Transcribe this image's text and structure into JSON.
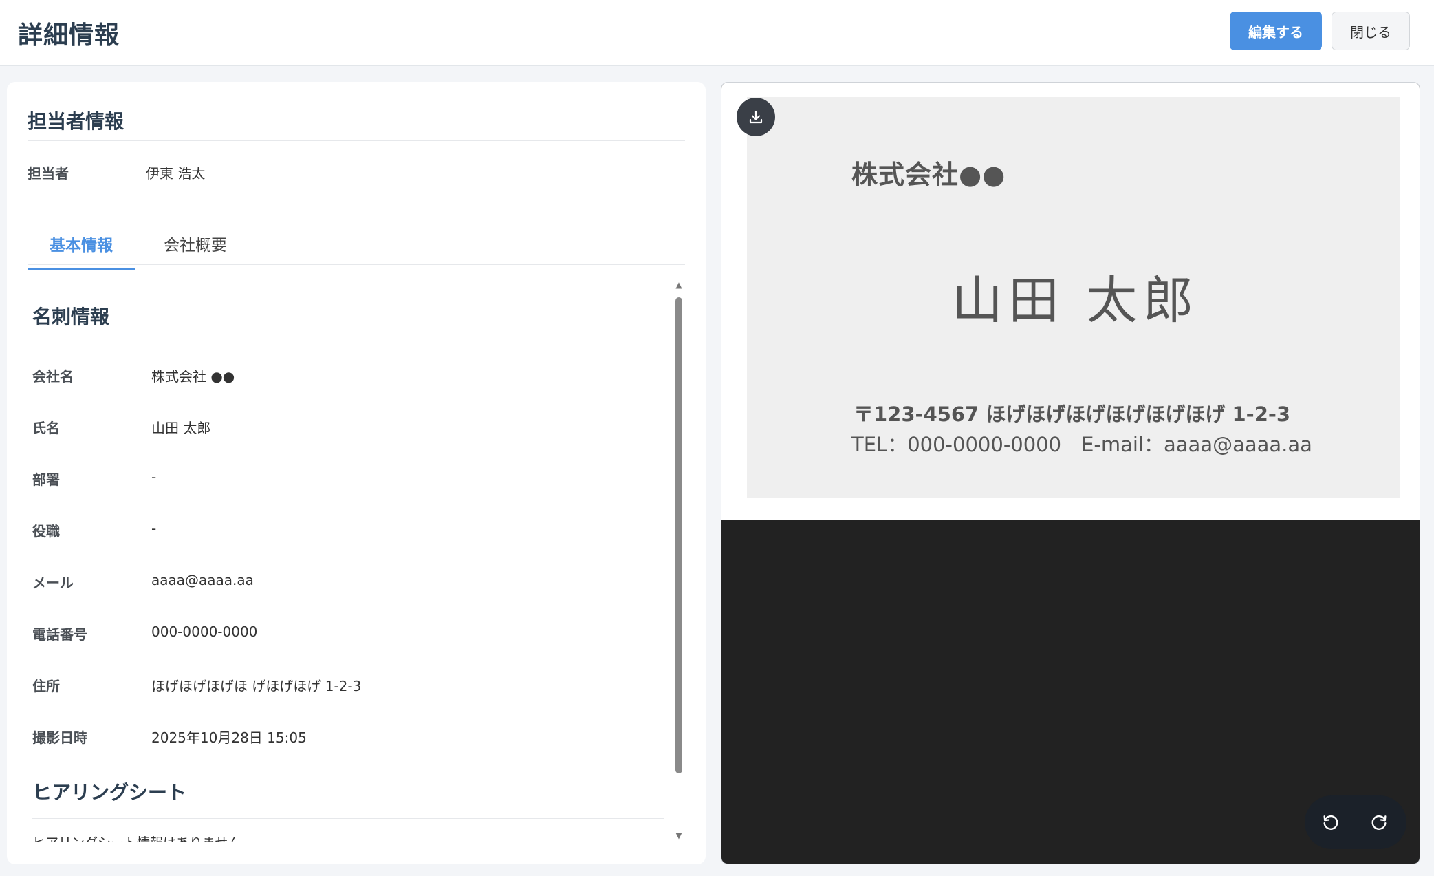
{
  "header": {
    "title": "詳細情報",
    "edit_label": "編集する",
    "close_label": "閉じる"
  },
  "assignee": {
    "section_title": "担当者情報",
    "label": "担当者",
    "value": "伊東 浩太"
  },
  "tabs": [
    {
      "label": "基本情報",
      "active": true
    },
    {
      "label": "会社概要",
      "active": false
    }
  ],
  "business_card_info": {
    "section_title": "名刺情報",
    "rows": [
      {
        "label": "会社名",
        "value": "株式会社 ●●"
      },
      {
        "label": "氏名",
        "value": "山田 太郎"
      },
      {
        "label": "部署",
        "value": "-"
      },
      {
        "label": "役職",
        "value": "-"
      },
      {
        "label": "メール",
        "value": "aaaa@aaaa.aa"
      },
      {
        "label": "電話番号",
        "value": "000-0000-0000"
      },
      {
        "label": "住所",
        "value": "ほげほげほげほ げほげほげ 1-2-3"
      },
      {
        "label": "撮影日時",
        "value": "2025年10月28日 15:05"
      }
    ]
  },
  "hearing_sheet": {
    "section_title": "ヒアリングシート",
    "empty_message": "ヒアリングシート情報はありません。"
  },
  "card_image": {
    "company": "株式会社●●",
    "name": "山田 太郎",
    "address": "〒123-4567 ほげほげほげほげほげほげ 1-2-3",
    "contact": "TEL：000-0000-0000　E-mail：aaaa@aaaa.aa"
  },
  "icons": {
    "download": "download-icon",
    "rotate_left": "rotate-left-icon",
    "rotate_right": "rotate-right-icon"
  },
  "colors": {
    "accent": "#4a90e2",
    "title": "#2c3e50",
    "image_background": "#222222"
  }
}
